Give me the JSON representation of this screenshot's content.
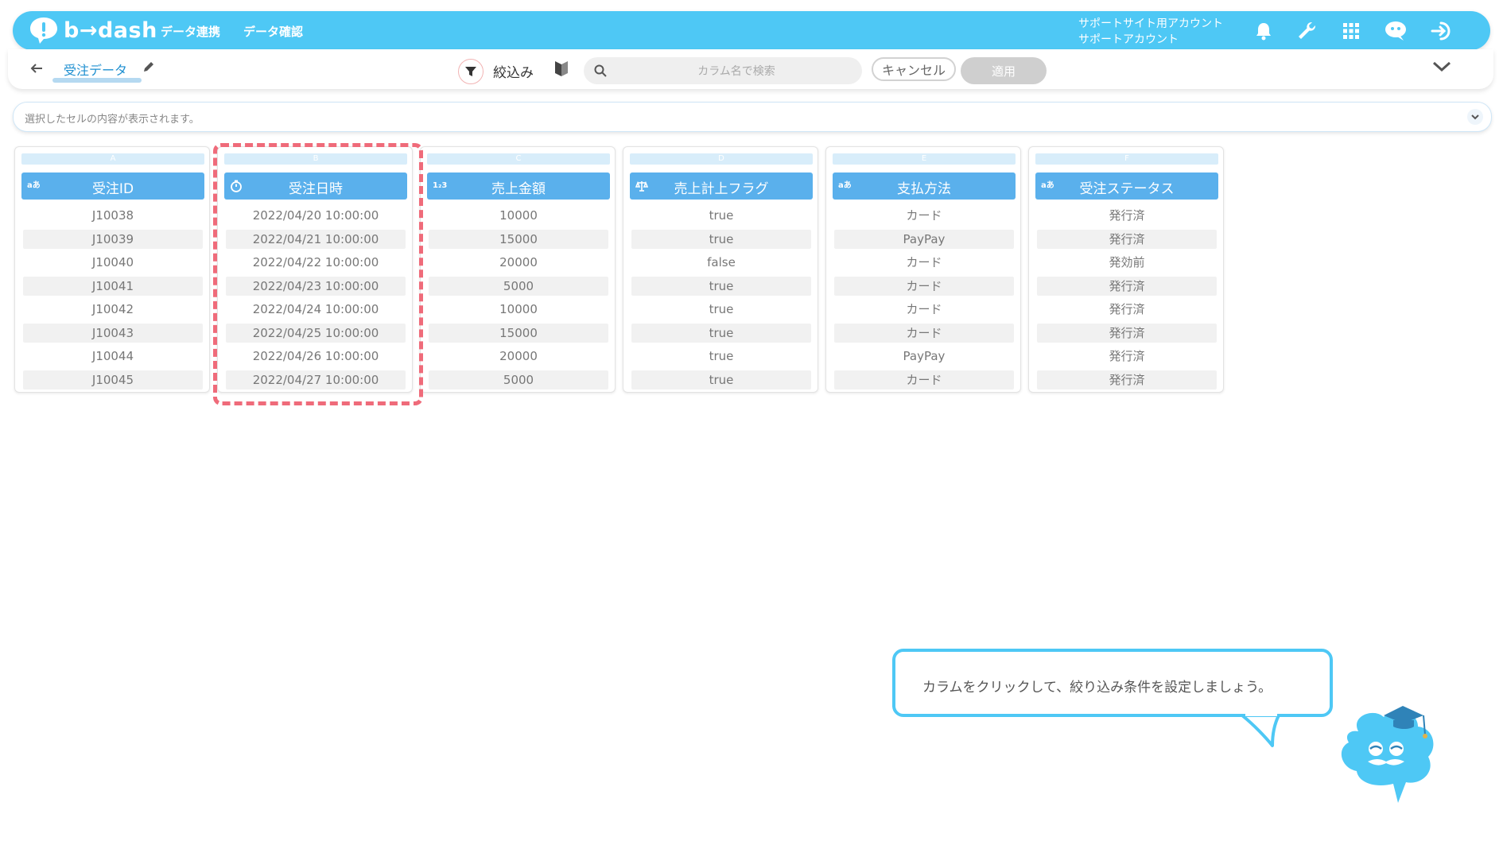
{
  "brand": {
    "name": "b→dash",
    "accent": "#4ec8f5",
    "header_blue": "#5ab0ec",
    "highlight": "#ef6b7a"
  },
  "nav": {
    "items": [
      "データ連携",
      "データ確認"
    ]
  },
  "account": {
    "line1": "サポートサイト用アカウント",
    "line2": "サポートアカウント"
  },
  "top_icons": [
    "bell-icon",
    "wrench-icon",
    "grid-icon",
    "chat-icon",
    "logout-icon"
  ],
  "toolbar": {
    "title": "受注データ",
    "filter_label": "絞込み",
    "search_placeholder": "カラム名で検索",
    "cancel_label": "キャンセル",
    "apply_label": "適用"
  },
  "cell_preview": {
    "placeholder": "選択したセルの内容が表示されます。"
  },
  "columns": [
    {
      "letter": "A",
      "type": "aあ",
      "name": "受注ID",
      "values": [
        "J10038",
        "J10039",
        "J10040",
        "J10041",
        "J10042",
        "J10043",
        "J10044",
        "J10045"
      ]
    },
    {
      "letter": "B",
      "type": "clock",
      "name": "受注日時",
      "values": [
        "2022/04/20 10:00:00",
        "2022/04/21 10:00:00",
        "2022/04/22 10:00:00",
        "2022/04/23 10:00:00",
        "2022/04/24 10:00:00",
        "2022/04/25 10:00:00",
        "2022/04/26 10:00:00",
        "2022/04/27 10:00:00"
      ]
    },
    {
      "letter": "C",
      "type": "1₂3",
      "name": "売上金額",
      "values": [
        "10000",
        "15000",
        "20000",
        "5000",
        "10000",
        "15000",
        "20000",
        "5000"
      ]
    },
    {
      "letter": "D",
      "type": "scale",
      "name": "売上計上フラグ",
      "values": [
        "true",
        "true",
        "false",
        "true",
        "true",
        "true",
        "true",
        "true"
      ]
    },
    {
      "letter": "E",
      "type": "aあ",
      "name": "支払方法",
      "values": [
        "カード",
        "PayPay",
        "カード",
        "カード",
        "カード",
        "カード",
        "PayPay",
        "カード"
      ]
    },
    {
      "letter": "F",
      "type": "aあ",
      "name": "受注ステータス",
      "values": [
        "発行済",
        "発行済",
        "発効前",
        "発行済",
        "発行済",
        "発行済",
        "発行済",
        "発行済"
      ]
    }
  ],
  "tooltip": {
    "text": "カラムをクリックして、絞り込み条件を設定しましょう。"
  }
}
